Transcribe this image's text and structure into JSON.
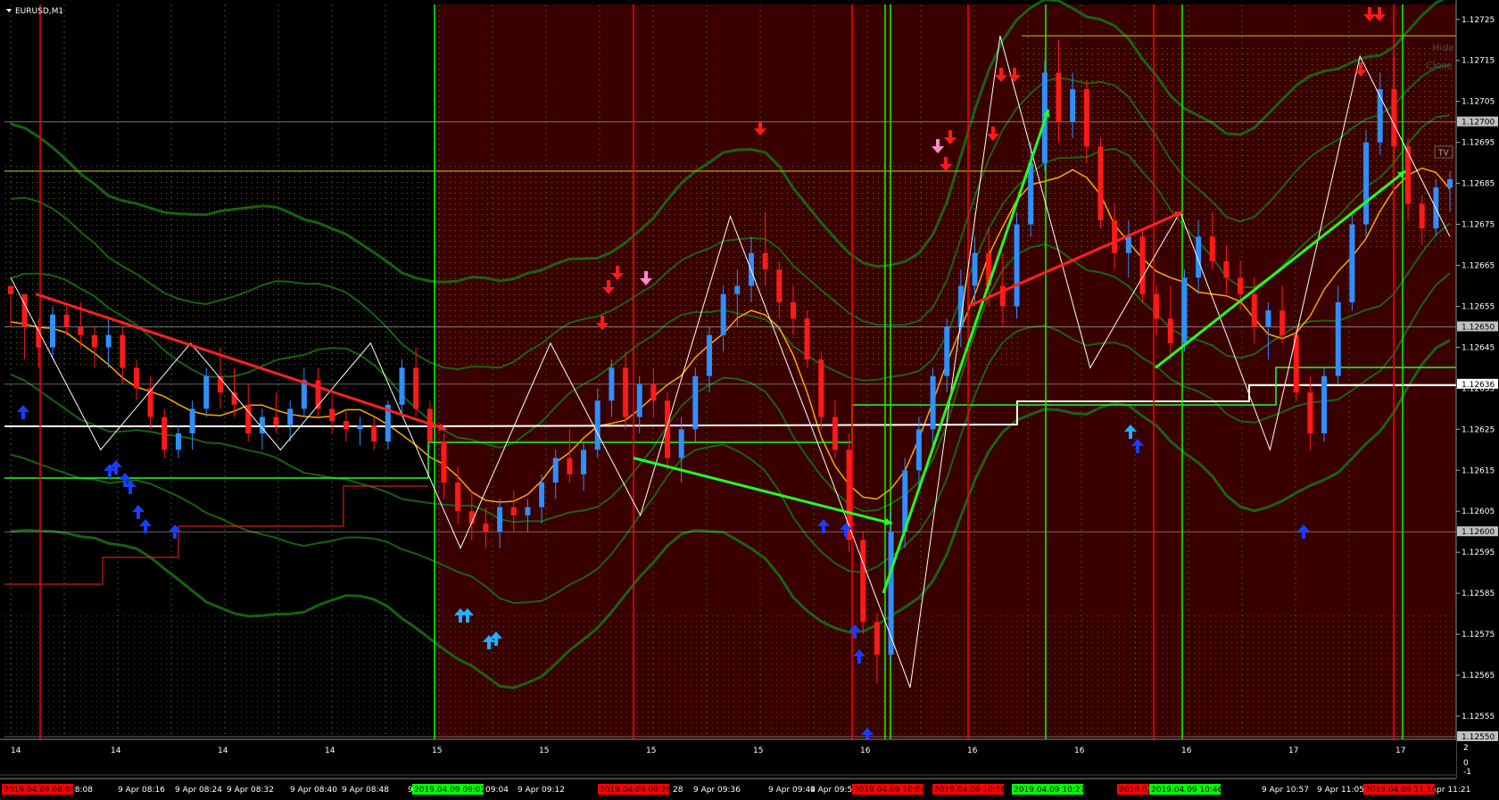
{
  "window": {
    "symbol_title": "EURUSD,M1"
  },
  "buttons": {
    "hide": "Hide",
    "close": "Close",
    "tv": "TV"
  },
  "colors": {
    "background": "#000000",
    "region_dark_red": "#3a0000",
    "bull_candle": "#2f8fff",
    "bear_candle": "#ff1a1a",
    "green_band": "#1a6b12",
    "ma_orange": "#ffa500",
    "zigzag": "#ffffff",
    "trend_green": "#22ff22",
    "trend_red": "#ff2020",
    "session_red": "#ff0000",
    "session_green": "#00ff00"
  },
  "price_axis": {
    "labels": [
      "1.12725",
      "1.12715",
      "1.12705",
      "1.12695",
      "1.12685",
      "1.12675",
      "1.12665",
      "1.12655",
      "1.12645",
      "1.12635",
      "1.12625",
      "1.12615",
      "1.12605",
      "1.12595",
      "1.12585",
      "1.12575",
      "1.12565",
      "1.12555"
    ],
    "highlights": [
      "1.12700",
      "1.12650",
      "1.12636",
      "1.12600",
      "1.12550"
    ]
  },
  "indicator_axis": {
    "labels": [
      "2",
      "0",
      "-1"
    ]
  },
  "indicator_row_labels": [
    "14",
    "14",
    "14",
    "14",
    "15",
    "15",
    "15",
    "15",
    "16",
    "16",
    "16",
    "16",
    "17",
    "17"
  ],
  "time_axis": {
    "labels": [
      "or 08:08",
      "9 Apr 08:16",
      "9 Apr 08:24",
      "9 Apr 08:32",
      "9 Apr 08:40",
      "9 Apr 08:48",
      "9",
      "09:04",
      "9 Apr 09:12",
      "28",
      "9 Apr 09:36",
      "9 Apr 09:44",
      "9 Apr 09:53",
      "0:",
      "9 Apr 1",
      "or 10:49",
      "9 Apr 10:57",
      "9 Apr 11:05",
      "Apr 11:21"
    ],
    "session_badges": [
      {
        "text": "2019.04.09 08:04",
        "color": "red"
      },
      {
        "text": "2019.04.09 09:02",
        "color": "green"
      },
      {
        "text": "2019.04.09 09:28",
        "color": "red"
      },
      {
        "text": "2019.04.09 10:04",
        "color": "red"
      },
      {
        "text": "2019.04.09 10:16",
        "color": "red"
      },
      {
        "text": "2019.04.09 10:27",
        "color": "green"
      },
      {
        "text": "2019.0",
        "color": "red"
      },
      {
        "text": "2019.04.09 10:46",
        "color": "green"
      },
      {
        "text": "2019.04.09 11:16",
        "color": "red"
      }
    ]
  },
  "chart_data": {
    "type": "candlestick",
    "symbol": "EURUSD",
    "timeframe": "M1",
    "ylim": [
      1.1255,
      1.12728
    ],
    "candles": [
      [
        1.1266,
        1.12658,
        1.1265,
        1.12658
      ],
      [
        1.12658,
        1.1265,
        1.12642,
        1.1265
      ],
      [
        1.1265,
        1.12652,
        1.1264,
        1.12645
      ],
      [
        1.12645,
        1.12655,
        1.12642,
        1.12653
      ],
      [
        1.12653,
        1.12655,
        1.12648,
        1.1265
      ],
      [
        1.1265,
        1.12656,
        1.12645,
        1.12648
      ],
      [
        1.12648,
        1.1265,
        1.1264,
        1.12645
      ],
      [
        1.12645,
        1.12652,
        1.1264,
        1.12648
      ],
      [
        1.12648,
        1.1265,
        1.12636,
        1.1264
      ],
      [
        1.1264,
        1.12642,
        1.12632,
        1.12635
      ],
      [
        1.12635,
        1.12638,
        1.12625,
        1.12628
      ],
      [
        1.12628,
        1.1263,
        1.12618,
        1.1262
      ],
      [
        1.1262,
        1.12626,
        1.12618,
        1.12624
      ],
      [
        1.12624,
        1.12632,
        1.1262,
        1.1263
      ],
      [
        1.1263,
        1.1264,
        1.12628,
        1.12638
      ],
      [
        1.12638,
        1.12645,
        1.1263,
        1.12634
      ],
      [
        1.12634,
        1.1264,
        1.12628,
        1.12631
      ],
      [
        1.12631,
        1.12636,
        1.12622,
        1.12624
      ],
      [
        1.12624,
        1.1263,
        1.1262,
        1.12628
      ],
      [
        1.12628,
        1.12634,
        1.12624,
        1.12626
      ],
      [
        1.12626,
        1.12632,
        1.12622,
        1.1263
      ],
      [
        1.1263,
        1.1264,
        1.12628,
        1.12637
      ],
      [
        1.12637,
        1.1264,
        1.12628,
        1.1263
      ],
      [
        1.1263,
        1.12633,
        1.12624,
        1.12627
      ],
      [
        1.12627,
        1.1263,
        1.12622,
        1.12625
      ],
      [
        1.12625,
        1.12628,
        1.12621,
        1.12626
      ],
      [
        1.12626,
        1.12628,
        1.1262,
        1.12622
      ],
      [
        1.12622,
        1.12632,
        1.1262,
        1.12631
      ],
      [
        1.12631,
        1.12642,
        1.12628,
        1.1264
      ],
      [
        1.1264,
        1.12645,
        1.12628,
        1.1263
      ],
      [
        1.1263,
        1.12632,
        1.1262,
        1.12622
      ],
      [
        1.12622,
        1.12624,
        1.12608,
        1.12612
      ],
      [
        1.12612,
        1.12616,
        1.12602,
        1.12605
      ],
      [
        1.12605,
        1.1261,
        1.12598,
        1.12602
      ],
      [
        1.12602,
        1.12606,
        1.12596,
        1.126
      ],
      [
        1.126,
        1.12608,
        1.12596,
        1.12606
      ],
      [
        1.12606,
        1.1261,
        1.126,
        1.12604
      ],
      [
        1.12604,
        1.12608,
        1.126,
        1.12606
      ],
      [
        1.12606,
        1.12614,
        1.12602,
        1.12612
      ],
      [
        1.12612,
        1.1262,
        1.12608,
        1.12618
      ],
      [
        1.12618,
        1.12625,
        1.12612,
        1.12614
      ],
      [
        1.12614,
        1.12622,
        1.1261,
        1.1262
      ],
      [
        1.1262,
        1.12635,
        1.12618,
        1.12632
      ],
      [
        1.12632,
        1.12642,
        1.12628,
        1.1264
      ],
      [
        1.1264,
        1.12644,
        1.12625,
        1.12628
      ],
      [
        1.12628,
        1.12638,
        1.12624,
        1.12636
      ],
      [
        1.12636,
        1.1264,
        1.12628,
        1.12632
      ],
      [
        1.12632,
        1.12634,
        1.12615,
        1.12618
      ],
      [
        1.12618,
        1.12628,
        1.12612,
        1.12625
      ],
      [
        1.12625,
        1.1264,
        1.12622,
        1.12638
      ],
      [
        1.12638,
        1.1265,
        1.12634,
        1.12648
      ],
      [
        1.12648,
        1.1266,
        1.12644,
        1.12658
      ],
      [
        1.12658,
        1.12664,
        1.1265,
        1.1266
      ],
      [
        1.1266,
        1.12672,
        1.12656,
        1.12668
      ],
      [
        1.12668,
        1.12678,
        1.1266,
        1.12664
      ],
      [
        1.12664,
        1.12666,
        1.12652,
        1.12656
      ],
      [
        1.12656,
        1.1266,
        1.12648,
        1.12652
      ],
      [
        1.12652,
        1.12654,
        1.1264,
        1.12642
      ],
      [
        1.12642,
        1.12644,
        1.12625,
        1.12628
      ],
      [
        1.12628,
        1.12632,
        1.12618,
        1.1262
      ],
      [
        1.1262,
        1.12624,
        1.12595,
        1.12598
      ],
      [
        1.12598,
        1.126,
        1.12575,
        1.12578
      ],
      [
        1.12578,
        1.1258,
        1.12563,
        1.1257
      ],
      [
        1.1257,
        1.12605,
        1.12568,
        1.126
      ],
      [
        1.126,
        1.12618,
        1.12596,
        1.12615
      ],
      [
        1.12615,
        1.12628,
        1.1261,
        1.12625
      ],
      [
        1.12625,
        1.1264,
        1.1262,
        1.12638
      ],
      [
        1.12638,
        1.12652,
        1.12634,
        1.1265
      ],
      [
        1.1265,
        1.12664,
        1.12645,
        1.1266
      ],
      [
        1.1266,
        1.12672,
        1.12655,
        1.12668
      ],
      [
        1.12668,
        1.12674,
        1.12655,
        1.1266
      ],
      [
        1.1266,
        1.12668,
        1.1265,
        1.12655
      ],
      [
        1.12655,
        1.12678,
        1.12652,
        1.12675
      ],
      [
        1.12675,
        1.12695,
        1.12672,
        1.1269
      ],
      [
        1.1269,
        1.12715,
        1.12688,
        1.12712
      ],
      [
        1.12712,
        1.1272,
        1.12695,
        1.127
      ],
      [
        1.127,
        1.12712,
        1.12696,
        1.12708
      ],
      [
        1.12708,
        1.1271,
        1.1269,
        1.12694
      ],
      [
        1.12694,
        1.12696,
        1.12674,
        1.12676
      ],
      [
        1.12676,
        1.1268,
        1.12664,
        1.12668
      ],
      [
        1.12668,
        1.12676,
        1.12662,
        1.12672
      ],
      [
        1.12672,
        1.12674,
        1.12656,
        1.12658
      ],
      [
        1.12658,
        1.1266,
        1.12648,
        1.12652
      ],
      [
        1.12652,
        1.1266,
        1.12642,
        1.12646
      ],
      [
        1.12646,
        1.12664,
        1.12644,
        1.12662
      ],
      [
        1.12662,
        1.12676,
        1.12658,
        1.12672
      ],
      [
        1.12672,
        1.12678,
        1.12664,
        1.12666
      ],
      [
        1.12666,
        1.1267,
        1.12658,
        1.12662
      ],
      [
        1.12662,
        1.12666,
        1.12654,
        1.12658
      ],
      [
        1.12658,
        1.12662,
        1.12646,
        1.1265
      ],
      [
        1.1265,
        1.12656,
        1.12642,
        1.12654
      ],
      [
        1.12654,
        1.1266,
        1.12646,
        1.12648
      ],
      [
        1.12648,
        1.1265,
        1.12632,
        1.12634
      ],
      [
        1.12634,
        1.12638,
        1.1262,
        1.12624
      ],
      [
        1.12624,
        1.1264,
        1.12622,
        1.12638
      ],
      [
        1.12638,
        1.1266,
        1.12636,
        1.12656
      ],
      [
        1.12656,
        1.12678,
        1.12654,
        1.12675
      ],
      [
        1.12675,
        1.12698,
        1.12672,
        1.12695
      ],
      [
        1.12695,
        1.12712,
        1.12692,
        1.12708
      ],
      [
        1.12708,
        1.12716,
        1.1269,
        1.12694
      ],
      [
        1.12694,
        1.12696,
        1.12676,
        1.1268
      ],
      [
        1.1268,
        1.12682,
        1.1267,
        1.12674
      ],
      [
        1.12674,
        1.12686,
        1.12672,
        1.12684
      ],
      [
        1.12684,
        1.12688,
        1.12678,
        1.12686
      ]
    ],
    "horizontal_levels": [
      1.127,
      1.1265,
      1.12636,
      1.126,
      1.1255
    ],
    "zigzag_prices": [
      1.12662,
      1.1262,
      1.12646,
      1.1262,
      1.12646,
      1.12596,
      1.12646,
      1.12604,
      1.12677,
      1.1262,
      1.12562,
      1.12721,
      1.1264,
      1.12678,
      1.1262,
      1.12716,
      1.12672
    ],
    "trend_lines": [
      {
        "color": "red",
        "from": 1.12658,
        "to": 1.12625
      },
      {
        "color": "green",
        "from": 1.12618,
        "to": 1.12602
      },
      {
        "color": "green",
        "from": 1.12585,
        "to": 1.12703
      },
      {
        "color": "red",
        "from": 1.12655,
        "to": 1.12678
      },
      {
        "color": "green",
        "from": 1.1264,
        "to": 1.12688
      }
    ]
  }
}
